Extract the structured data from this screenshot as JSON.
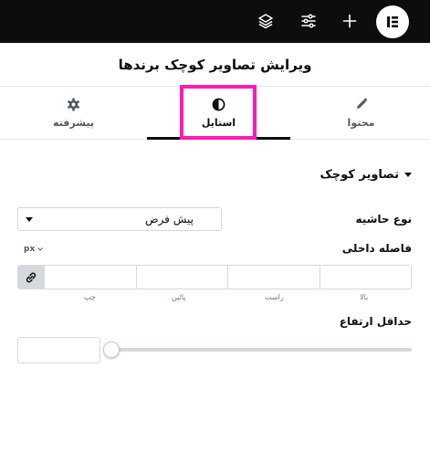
{
  "topbar": {
    "icons": [
      "layers-icon",
      "sliders-icon",
      "plus-icon",
      "elementor-logo"
    ]
  },
  "panel": {
    "title": "ویرایش تصاویر کوچک برندها"
  },
  "tabs": [
    {
      "label": "محتوا",
      "icon": "pencil-icon"
    },
    {
      "label": "استایل",
      "icon": "half-circle-icon",
      "active": true
    },
    {
      "label": "پیشرفته",
      "icon": "gear-icon"
    }
  ],
  "section": {
    "title": "تصاویر کوچک"
  },
  "border_type": {
    "label": "نوع حاشیه",
    "value": "پیش فرض"
  },
  "padding": {
    "label": "فاصله داخلی",
    "unit": "px",
    "fields": [
      "بالا",
      "راست",
      "پائین",
      "چپ"
    ]
  },
  "min_height": {
    "label": "حداقل ارتفاع",
    "value": ""
  },
  "colors": {
    "topbar": "#0c0d0e",
    "highlight": "#ff1ab5"
  }
}
